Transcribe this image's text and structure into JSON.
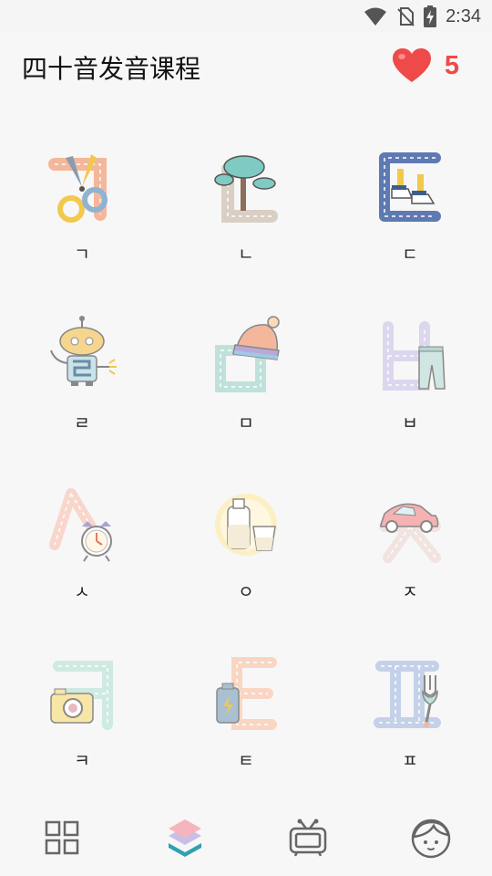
{
  "status_bar": {
    "time": "2:34",
    "icons": [
      "wifi-icon",
      "no-sim-icon",
      "battery-charging-icon"
    ]
  },
  "header": {
    "title": "四十音发音课程",
    "lives_icon": "heart-icon",
    "lives": "5"
  },
  "colors": {
    "heart": "#ef4a4a",
    "nav_active_teal": "#2fa1b0",
    "nav_active_pink": "#f6b5bd",
    "nav_active_lavender": "#c9bfe6"
  },
  "letters": [
    {
      "char": "ㄱ",
      "illustration": "scissors-icon"
    },
    {
      "char": "ㄴ",
      "illustration": "tree-icon"
    },
    {
      "char": "ㄷ",
      "illustration": "sneakers-icon"
    },
    {
      "char": "ㄹ",
      "illustration": "robot-icon"
    },
    {
      "char": "ㅁ",
      "illustration": "knit-hat-icon"
    },
    {
      "char": "ㅂ",
      "illustration": "pants-icon"
    },
    {
      "char": "ㅅ",
      "illustration": "alarm-clock-icon"
    },
    {
      "char": "ㅇ",
      "illustration": "milk-icon"
    },
    {
      "char": "ㅈ",
      "illustration": "car-icon"
    },
    {
      "char": "ㅋ",
      "illustration": "camera-icon"
    },
    {
      "char": "ㅌ",
      "illustration": "battery-icon"
    },
    {
      "char": "ㅍ",
      "illustration": "fork-icon"
    }
  ],
  "bottom_nav": [
    {
      "icon": "grid-icon",
      "active": false
    },
    {
      "icon": "layers-icon",
      "active": true
    },
    {
      "icon": "tv-icon",
      "active": false
    },
    {
      "icon": "profile-icon",
      "active": false
    }
  ]
}
